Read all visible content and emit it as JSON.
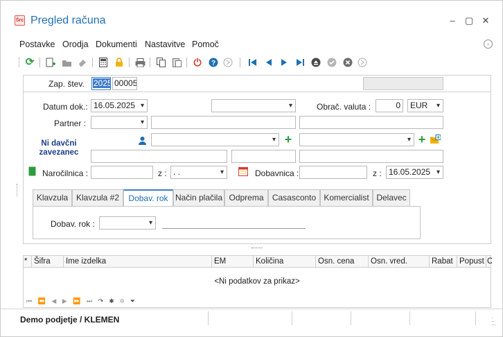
{
  "window": {
    "title": "Pregled računa",
    "icon_text": "Šrc"
  },
  "controls": {
    "minimize": "–",
    "maximize": "▢",
    "close": "✕"
  },
  "menu": [
    "Postavke",
    "Orodja",
    "Dokumenti",
    "Nastavitve",
    "Pomoč"
  ],
  "form": {
    "zap_stev_label": "Zap. štev.",
    "zap_stev_year": "2025",
    "zap_stev_number": "00005",
    "datum_label": "Datum dok.:",
    "datum_value": "16.05.2025",
    "obrac_valuta_label": "Obrač. valuta :",
    "valuta_amount": "0",
    "valuta_currency": "EUR",
    "partner_label": "Partner :",
    "tax_status": "Ni davčni zavezanec",
    "narocilnica_label": "Naročilnica :",
    "narocilnica_z_label": "z :",
    "narocilnica_date": ". .",
    "dobavnica_label": "Dobavnica :",
    "dobavnica_z_label": "z :",
    "dobavnica_date": "16.05.2025"
  },
  "tabs": [
    "Klavzula",
    "Klavzula #2",
    "Dobav. rok",
    "Način plačila",
    "Odprema",
    "Casasconto",
    "Komercialist",
    "Delavec"
  ],
  "active_tab": "Dobav. rok",
  "tab_content": {
    "dobav_rok_label": "Dobav. rok :"
  },
  "grid": {
    "columns": [
      "*",
      "Šifra",
      "Ime izdelka",
      "EM",
      "Količina",
      "Osn. cena",
      "Osn. vred.",
      "Rabat",
      "Popust",
      "C"
    ],
    "empty_text": "<Ni podatkov za prikaz>"
  },
  "status": {
    "company": "Demo podjetje / KLEMEN"
  },
  "colors": {
    "accent": "#1f6fb2",
    "green": "#2e9b3e",
    "red": "#d83b2b"
  }
}
